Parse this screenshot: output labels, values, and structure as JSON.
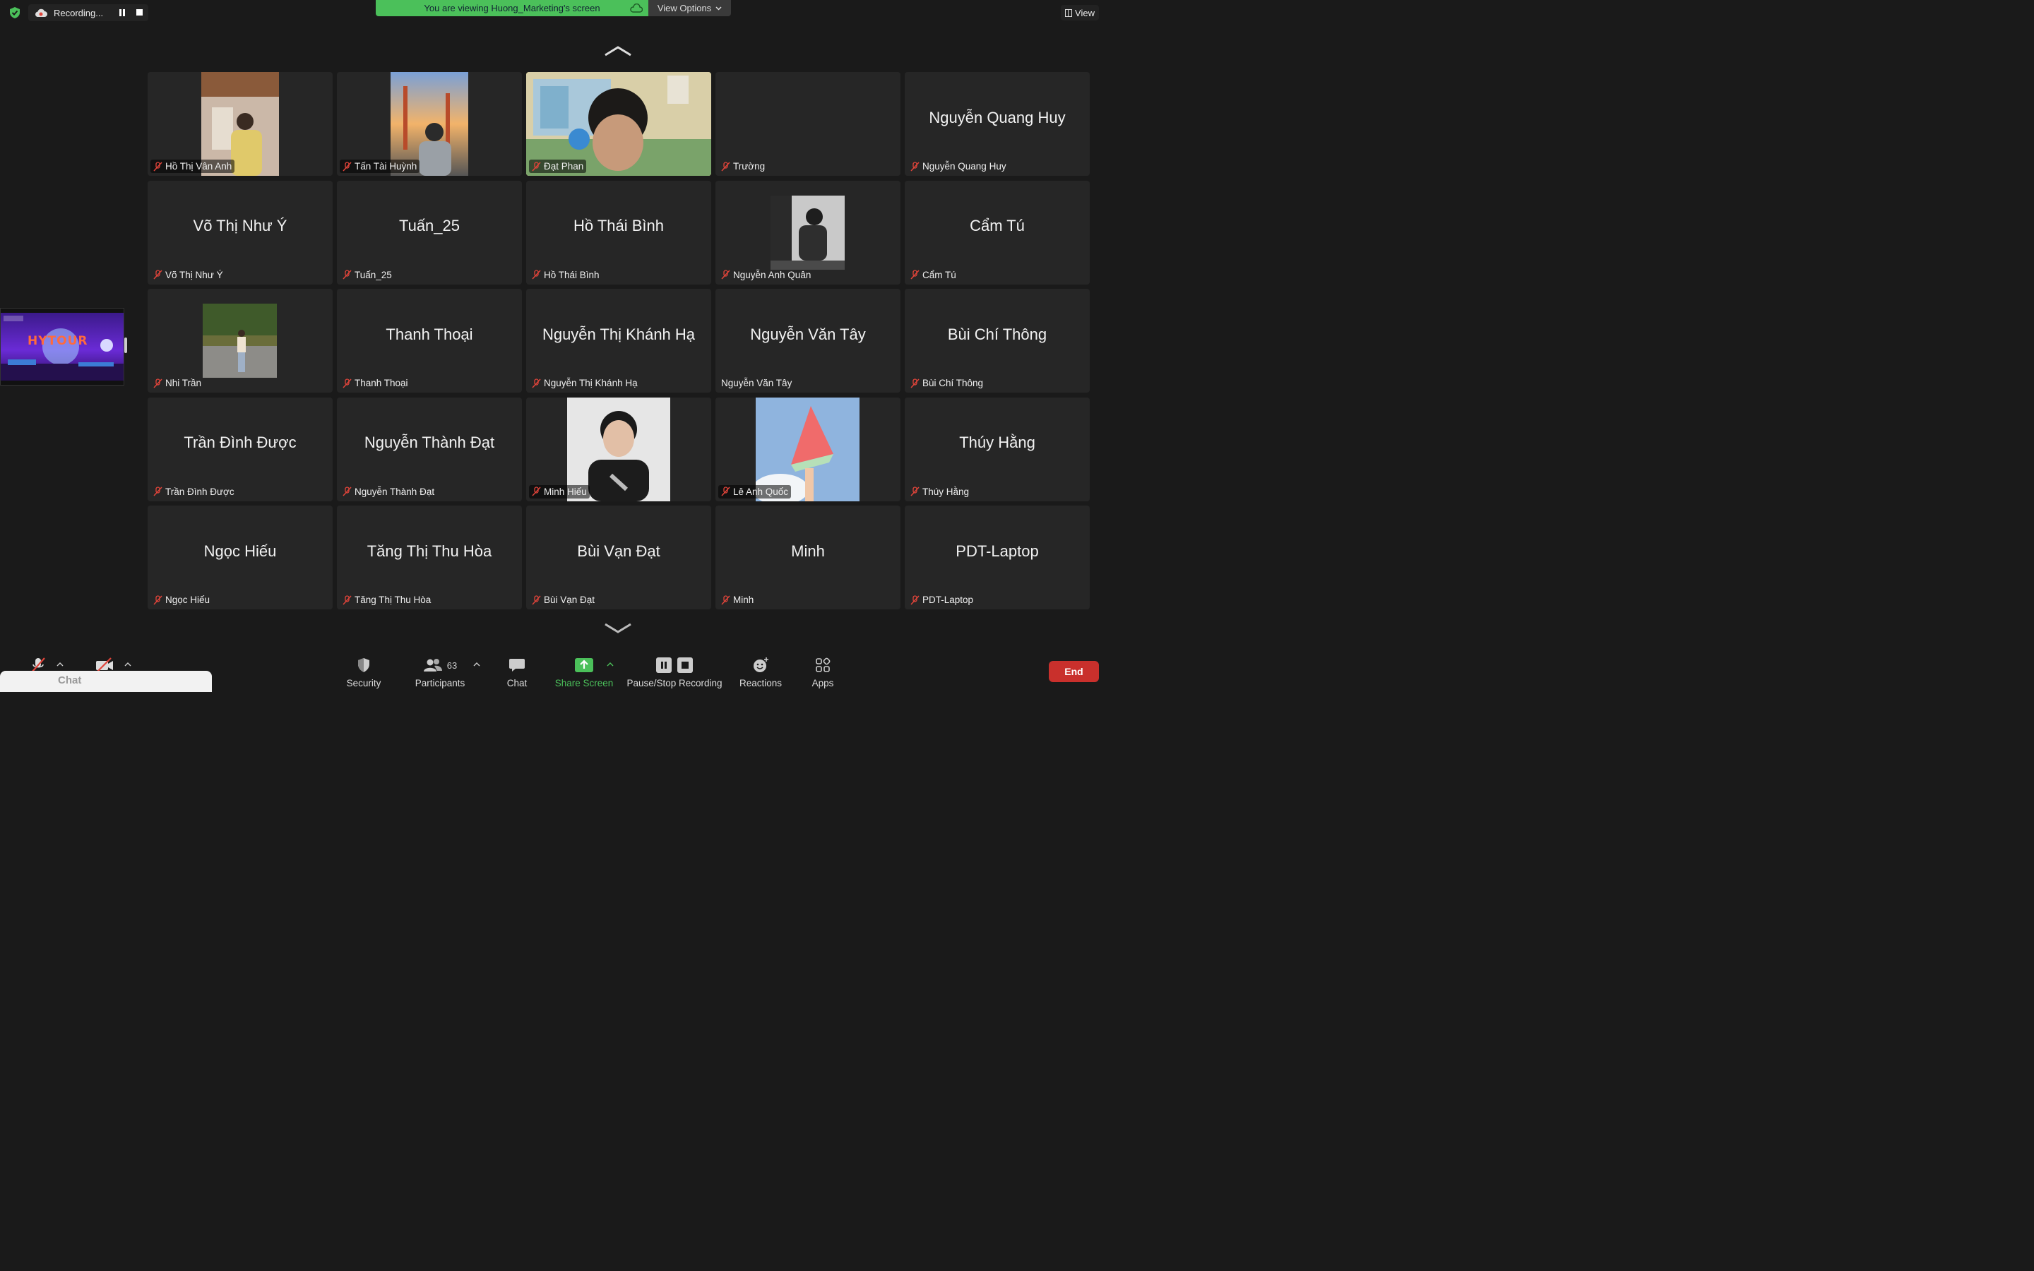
{
  "top_bar": {
    "recording_label": "Recording...",
    "viewing_text": "You are viewing Huong_Marketing's screen",
    "view_options_label": "View Options",
    "view_label": "View"
  },
  "colors": {
    "accent_green": "#4bc05a",
    "end_red": "#c9302c",
    "active_speaker": "#d9c24a"
  },
  "share_thumbnail": {
    "title": "HYTOUR"
  },
  "participants": [
    {
      "center_name": "",
      "label": "Hồ Thị Vân Anh",
      "muted": true
    },
    {
      "center_name": "",
      "label": "Tấn Tài Huỳnh",
      "muted": true
    },
    {
      "center_name": "",
      "label": "Đạt Phan",
      "muted": true
    },
    {
      "center_name": "",
      "label": "Trường",
      "muted": true
    },
    {
      "center_name": "Nguyễn Quang Huy",
      "label": "Nguyễn Quang Huy",
      "muted": true
    },
    {
      "center_name": "Võ Thị Như Ý",
      "label": "Võ Thị Như Ý",
      "muted": true
    },
    {
      "center_name": "Tuấn_25",
      "label": "Tuấn_25",
      "muted": true
    },
    {
      "center_name": "Hồ Thái Bình",
      "label": "Hồ Thái Bình",
      "muted": true
    },
    {
      "center_name": "",
      "label": "Nguyễn Anh Quân",
      "muted": true
    },
    {
      "center_name": "Cẩm Tú",
      "label": "Cẩm Tú",
      "muted": true
    },
    {
      "center_name": "",
      "label": "Nhi Trần",
      "muted": true
    },
    {
      "center_name": "Thanh Thoại",
      "label": "Thanh Thoại",
      "muted": true
    },
    {
      "center_name": "Nguyễn Thị Khánh Hạ",
      "label": "Nguyễn Thị Khánh Hạ",
      "muted": true
    },
    {
      "center_name": "Nguyễn Văn Tây",
      "label": "Nguyễn Văn Tây",
      "muted": false
    },
    {
      "center_name": "Bùi Chí Thông",
      "label": "Bùi Chí Thông",
      "muted": true
    },
    {
      "center_name": "Trần Đình Được",
      "label": "Trần Đình Được",
      "muted": true
    },
    {
      "center_name": "Nguyễn Thành Đạt",
      "label": "Nguyễn Thành Đạt",
      "muted": true
    },
    {
      "center_name": "",
      "label": "Minh Hiếu",
      "muted": true
    },
    {
      "center_name": "",
      "label": "Lê Anh Quốc",
      "muted": true
    },
    {
      "center_name": "Thúy Hằng",
      "label": "Thúy Hằng",
      "muted": true
    },
    {
      "center_name": "Ngọc Hiếu",
      "label": "Ngọc Hiếu",
      "muted": true
    },
    {
      "center_name": "Tăng Thị Thu Hòa",
      "label": "Tăng Thị Thu Hòa",
      "muted": true
    },
    {
      "center_name": "Bùi Vạn Đạt",
      "label": "Bùi Vạn Đạt",
      "muted": true
    },
    {
      "center_name": "Minh",
      "label": "Minh",
      "muted": true
    },
    {
      "center_name": "PDT-Laptop",
      "label": "PDT-Laptop",
      "muted": true
    }
  ],
  "toolbar": {
    "security": "Security",
    "participants": "Participants",
    "participant_count": "63",
    "chat": "Chat",
    "share_screen": "Share Screen",
    "pause_stop_recording": "Pause/Stop Recording",
    "reactions": "Reactions",
    "apps": "Apps",
    "end": "End"
  },
  "chat_popup": {
    "label": "Chat"
  }
}
